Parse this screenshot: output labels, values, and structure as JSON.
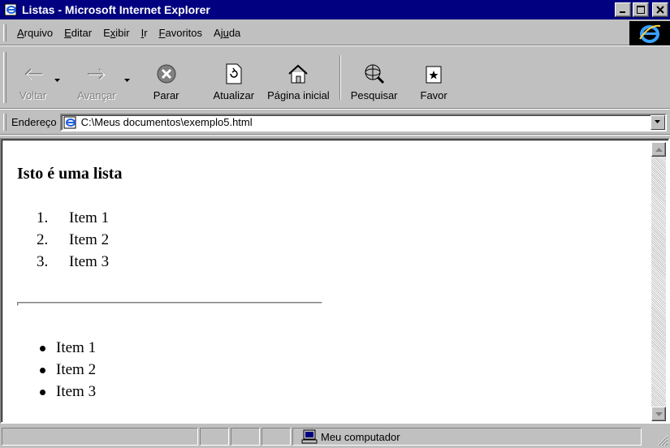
{
  "window": {
    "title": "Listas - Microsoft Internet Explorer"
  },
  "menu": {
    "items": [
      {
        "u": "A",
        "rest": "rquivo"
      },
      {
        "u": "E",
        "rest": "ditar"
      },
      {
        "pre": "E",
        "u": "x",
        "rest": "ibir"
      },
      {
        "u": "I",
        "rest": "r"
      },
      {
        "u": "F",
        "rest": "avoritos"
      },
      {
        "pre": "Aj",
        "u": "u",
        "rest": "da"
      }
    ]
  },
  "toolbar": {
    "back": "Voltar",
    "forward": "Avançar",
    "stop": "Parar",
    "refresh": "Atualizar",
    "home": "Página inicial",
    "search": "Pesquisar",
    "favorites": "Favor"
  },
  "address": {
    "label": "Endereço",
    "value": "C:\\Meus documentos\\exemplo5.html"
  },
  "page": {
    "heading": "Isto é uma lista",
    "ordered": [
      {
        "num": "1.",
        "text": "Item 1"
      },
      {
        "num": "2.",
        "text": "Item 2"
      },
      {
        "num": "3.",
        "text": "Item 3"
      }
    ],
    "unordered": [
      "Item 1",
      "Item 2",
      "Item 3"
    ]
  },
  "status": {
    "zone": "Meu computador"
  },
  "colors": {
    "titlebar": "#000080",
    "chrome": "#c0c0c0"
  },
  "icons": [
    "ie-page-icon",
    "minimize-icon",
    "maximize-icon",
    "close-icon",
    "ie-logo-icon",
    "back-arrow-icon",
    "forward-arrow-icon",
    "stop-icon",
    "refresh-icon",
    "home-icon",
    "search-icon",
    "favorites-icon",
    "dropdown-icon",
    "computer-icon"
  ]
}
